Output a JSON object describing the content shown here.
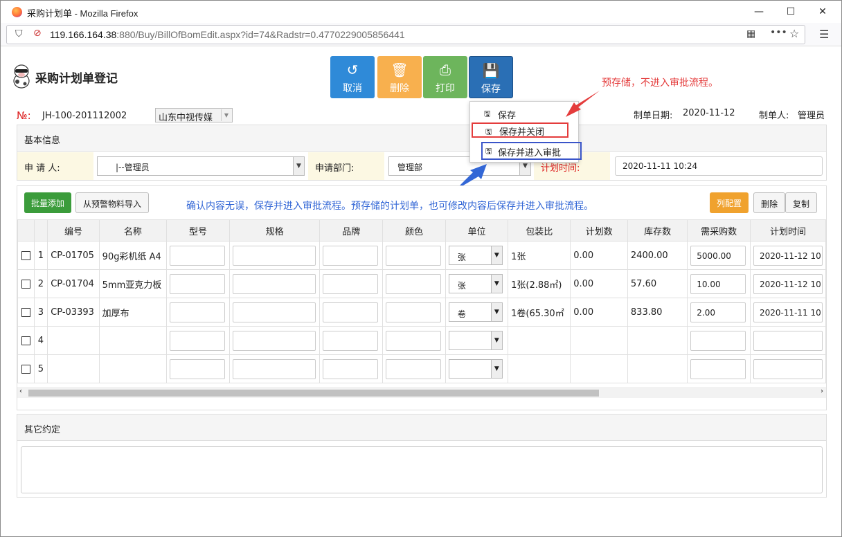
{
  "window": {
    "title": "采购计划单 - Mozilla Firefox",
    "url_host": "119.166.164.38",
    "url_rest": ":880/Buy/BillOfBomEdit.aspx?id=74&Radstr=0.477022900585644​1"
  },
  "header": {
    "title": "采购计划单登记",
    "no_label": "№:",
    "no_value": "JH-100-201112002",
    "company": "山东中视传媒",
    "date_label": "制单日期:",
    "date_value": "2020-11-12",
    "maker_label": "制单人:",
    "maker_value": "管理员"
  },
  "toolbar": {
    "cancel": "取消",
    "delete": "删除",
    "print": "打印",
    "save": "保存"
  },
  "save_menu": {
    "item1": "保存",
    "item2": "保存并关闭",
    "item3": "保存并进入审批"
  },
  "annotations": {
    "red": "预存储，不进入审批流程。",
    "blue": "确认内容无误，保存并进入审批流程。预存储的计划单，也可修改内容后保存并进入审批流程。"
  },
  "basic": {
    "heading": "基本信息",
    "applicant_label": "申 请 人:",
    "applicant_value": "|--管理员",
    "dept_label": "申请部门:",
    "dept_value": "管理部",
    "time_label": "计划时间:",
    "time_value": "2020-11-11 10:24"
  },
  "grid_toolbar": {
    "batch_add": "批量添加",
    "import": "从预警物料导入",
    "col_config": "列配置",
    "delete": "删除",
    "copy": "复制"
  },
  "columns": [
    "编号",
    "名称",
    "型号",
    "规格",
    "品牌",
    "颜色",
    "单位",
    "包装比",
    "计划数",
    "库存数",
    "需采购数",
    "计划时间"
  ],
  "rows": [
    {
      "n": "1",
      "code": "CP-01705",
      "name": "90g彩机纸 A4",
      "unit": "张",
      "pack": "1张",
      "plan": "0.00",
      "stock": "2400.00",
      "need": "5000.00",
      "time": "2020-11-12 10"
    },
    {
      "n": "2",
      "code": "CP-01704",
      "name": "5mm亚克力板",
      "unit": "张",
      "pack": "1张(2.88㎡)",
      "plan": "0.00",
      "stock": "57.60",
      "need": "10.00",
      "time": "2020-11-12 10"
    },
    {
      "n": "3",
      "code": "CP-03393",
      "name": "加厚布",
      "unit": "卷",
      "pack": "1卷(65.30㎡",
      "plan": "0.00",
      "stock": "833.80",
      "need": "2.00",
      "time": "2020-11-11 10"
    },
    {
      "n": "4",
      "code": "",
      "name": "",
      "unit": "",
      "pack": "",
      "plan": "",
      "stock": "",
      "need": "",
      "time": ""
    },
    {
      "n": "5",
      "code": "",
      "name": "",
      "unit": "",
      "pack": "",
      "plan": "",
      "stock": "",
      "need": "",
      "time": ""
    }
  ],
  "other": {
    "heading": "其它约定"
  }
}
